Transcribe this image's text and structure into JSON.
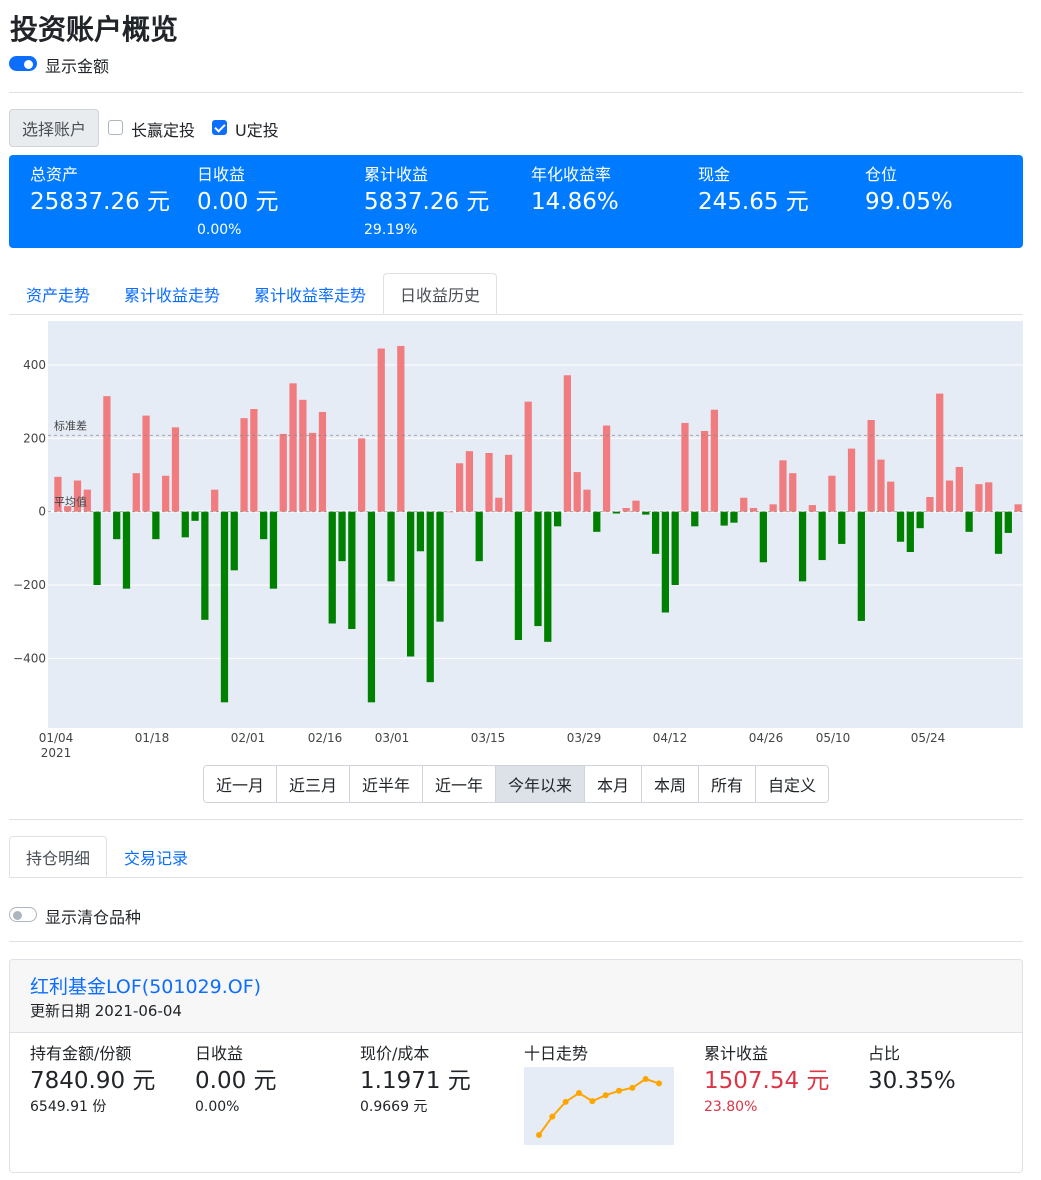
{
  "page": {
    "title": "投资账户概览"
  },
  "toggles": {
    "show_amount": "显示金额",
    "show_cleared": "显示清仓品种"
  },
  "filters": {
    "select_account": "选择账户",
    "accounts": [
      {
        "label": "长赢定投",
        "checked": false
      },
      {
        "label": "U定投",
        "checked": true
      }
    ]
  },
  "summary": {
    "total_assets": {
      "label": "总资产",
      "value": "25837.26 元"
    },
    "daily_return": {
      "label": "日收益",
      "value": "0.00 元",
      "sub": "0.00%"
    },
    "cumulative_return": {
      "label": "累计收益",
      "value": "5837.26 元",
      "sub": "29.19%"
    },
    "annualized_rate": {
      "label": "年化收益率",
      "value": "14.86%"
    },
    "cash": {
      "label": "现金",
      "value": "245.65 元"
    },
    "position": {
      "label": "仓位",
      "value": "99.05%"
    }
  },
  "chart_tabs": [
    "资产走势",
    "累计收益走势",
    "累计收益率走势",
    "日收益历史"
  ],
  "chart_active_tab": 3,
  "chart_data": {
    "type": "bar",
    "title": "",
    "xlabel": "",
    "ylabel": "",
    "ylim": [
      -590,
      520
    ],
    "yticks": [
      "400",
      "200",
      "0",
      "−200",
      "−400"
    ],
    "ytick_values": [
      400,
      200,
      0,
      -200,
      -400
    ],
    "xtick_labels": [
      "01/04",
      "01/18",
      "02/01",
      "02/16",
      "03/01",
      "03/15",
      "03/29",
      "04/12",
      "04/26",
      "05/10",
      "05/24"
    ],
    "xtick_year": "2021",
    "reference_lines": [
      {
        "label": "标准差",
        "value": 208
      },
      {
        "label": "平均值",
        "value": 0
      }
    ],
    "colors": {
      "positive": "#f07c7f",
      "negative": "#008000",
      "background": "#e5ecf6"
    },
    "values": [
      95,
      15,
      85,
      60,
      -200,
      315,
      -75,
      -210,
      105,
      262,
      -75,
      98,
      230,
      -70,
      -25,
      -295,
      60,
      -520,
      -160,
      255,
      280,
      -75,
      -210,
      212,
      350,
      305,
      215,
      272,
      -305,
      -135,
      -320,
      200,
      -520,
      445,
      -190,
      452,
      -395,
      -108,
      -465,
      -300,
      0,
      132,
      165,
      -135,
      160,
      38,
      155,
      -350,
      300,
      -312,
      -355,
      -40,
      372,
      108,
      60,
      -55,
      235,
      -5,
      10,
      30,
      -8,
      -115,
      -275,
      -200,
      242,
      -40,
      220,
      278,
      -38,
      -30,
      38,
      10,
      -138,
      20,
      140,
      105,
      -190,
      18,
      -132,
      98,
      -88,
      172,
      -298,
      250,
      142,
      82,
      -82,
      -110,
      -45,
      40,
      322,
      85,
      122,
      -55,
      75,
      80,
      -115,
      -58,
      20
    ]
  },
  "range_buttons": [
    "近一月",
    "近三月",
    "近半年",
    "近一年",
    "今年以来",
    "本月",
    "本周",
    "所有",
    "自定义"
  ],
  "range_active": 4,
  "holding_tabs": [
    "持仓明细",
    "交易记录"
  ],
  "fund": {
    "name": "红利基金LOF(501029.OF)",
    "update_date": "更新日期 2021-06-04",
    "holding": {
      "label": "持有金额/份额",
      "value": "7840.90 元",
      "sub": "6549.91 份"
    },
    "daily": {
      "label": "日收益",
      "value": "0.00 元",
      "sub": "0.00%"
    },
    "price": {
      "label": "现价/成本",
      "value": "1.1971 元",
      "sub": "0.9669 元"
    },
    "trend": {
      "label": "十日走势",
      "values": [
        1.09,
        1.115,
        1.135,
        1.147,
        1.136,
        1.144,
        1.15,
        1.154,
        1.166,
        1.16
      ],
      "color": "#ffa500"
    },
    "cumulative": {
      "label": "累计收益",
      "value": "1507.54 元",
      "sub": "23.80%"
    },
    "ratio": {
      "label": "占比",
      "value": "30.35%"
    }
  }
}
